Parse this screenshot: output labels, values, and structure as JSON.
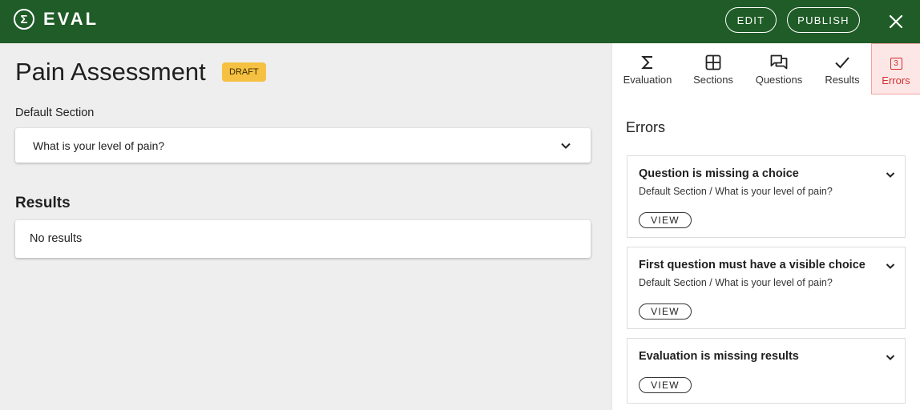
{
  "colors": {
    "topbar": "#1f5c27",
    "badge": "#f6c142",
    "error": "#d32f2f",
    "error_tab_bg": "#fde6e6"
  },
  "header": {
    "brand_mark": "Σ",
    "brand_name": "EVAL",
    "edit_label": "EDIT",
    "publish_label": "PUBLISH",
    "close_icon": "close-icon"
  },
  "main": {
    "title": "Pain Assessment",
    "status_badge": "DRAFT",
    "section_label": "Default Section",
    "question": "What is your level of pain?",
    "results_heading": "Results",
    "results_empty": "No results"
  },
  "panel": {
    "tabs": [
      {
        "label": "Evaluation",
        "icon": "sigma-icon"
      },
      {
        "label": "Sections",
        "icon": "grid-icon"
      },
      {
        "label": "Questions",
        "icon": "chat-icon"
      },
      {
        "label": "Results",
        "icon": "check-icon"
      },
      {
        "label": "Errors",
        "icon": "error-count-icon",
        "count": "3",
        "active": true
      }
    ],
    "title": "Errors",
    "errors": [
      {
        "title": "Question is missing a choice",
        "path": "Default Section / What is your level of pain?",
        "action": "VIEW"
      },
      {
        "title": "First question must have a visible choice",
        "path": "Default Section / What is your level of pain?",
        "action": "VIEW"
      },
      {
        "title": "Evaluation is missing results",
        "action": "VIEW"
      }
    ]
  }
}
